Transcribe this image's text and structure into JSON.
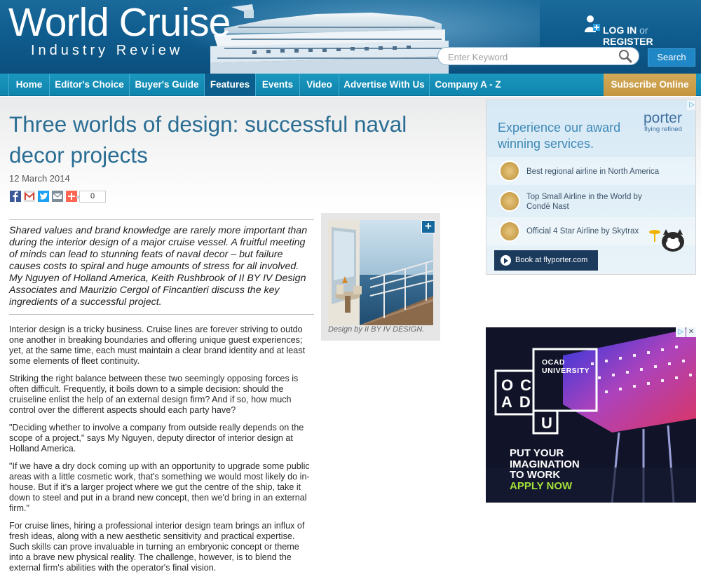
{
  "header": {
    "logo_main": "World Cruise",
    "logo_sub": "Industry Review",
    "login_label": "LOG IN",
    "or_label": "or",
    "register_label": "REGISTER",
    "search_placeholder": "Enter Keyword",
    "search_button": "Search"
  },
  "nav": {
    "items": [
      "Home",
      "Editor's Choice",
      "Buyer's Guide",
      "Features",
      "Events",
      "Video",
      "Advertise With Us",
      "Company A - Z"
    ],
    "active": "Features",
    "subscribe": "Subscribe Online"
  },
  "article": {
    "title": "Three worlds of design: successful naval decor projects",
    "date": "12 March 2014",
    "share_icons": [
      "facebook-icon",
      "gmail-icon",
      "twitter-icon",
      "email-icon",
      "more-share-icon"
    ],
    "share_count": "0",
    "lede": "Shared values and brand knowledge are rarely more important than during the interior design of a major cruise vessel. A fruitful meeting of minds can lead to stunning feats of naval decor – but failure causes costs to spiral and huge amounts of stress for all involved. My Nguyen of Holland America, Keith Rushbrook of II BY IV Design Associates and Maurizio Cergol of Fincantieri discuss the key ingredients of a successful project.",
    "paragraphs": [
      "Interior design is a tricky business. Cruise lines are forever striving to outdo one another in breaking boundaries and offering unique guest experiences; yet, at the same time, each must maintain a clear brand identity and at least some elements of fleet continuity.",
      "Striking the right balance between these two seemingly opposing forces is often difficult. Frequently, it boils down to a simple decision: should the cruiseline enlist the help of an external design firm? And if so, how much control over the different aspects should each party have?",
      "\"Deciding whether to involve a company from outside really depends on the scope of a project,\" says My Nguyen, deputy director of interior design at Holland America.",
      "\"If we have a dry dock coming up with an opportunity to upgrade some public areas with a little cosmetic work, that's something we would most likely do in-house. But if it's a larger project where we gut the centre of the ship, take it down to steel and put in a brand new concept, then we'd bring in an external firm.\"",
      "For cruise lines, hiring a professional interior design team brings an influx of fresh ideas, along with a new aesthetic sensitivity and practical expertise. Such skills can prove invaluable in turning an embryonic concept or theme into a brave new physical reality. The challenge, however, is to blend the external firm's abilities with the operator's final vision."
    ],
    "figure_caption": "Design by II BY IV DESIGN.",
    "figure_expand": "+"
  },
  "ads": {
    "porter": {
      "headline": "Experience our award winning services.",
      "brand": "porter",
      "tagline": "flying refined",
      "awards": [
        "Best regional airline in North America",
        "Top Small Airline in the World by Condé Nast",
        "Official 4 Star Airline by Skytrax"
      ],
      "button": "Book at flyporter.com"
    },
    "ocad": {
      "letters_row1": "OC",
      "letters_row2": "AD",
      "letters_u": "U",
      "university": "OCAD\nUNIVERSITY",
      "cta_lines": [
        "PUT YOUR",
        "IMAGINATION",
        "TO WORK"
      ],
      "apply": "APPLY NOW"
    },
    "adchoice_icon": "adchoices-icon"
  }
}
